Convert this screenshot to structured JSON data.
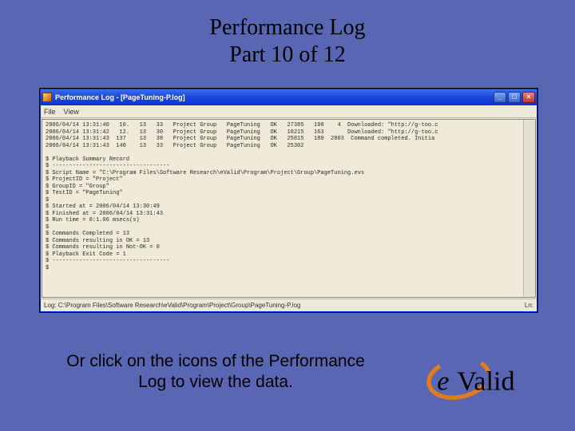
{
  "slide": {
    "title_line1": "Performance Log",
    "title_line2": "Part 10 of 12",
    "caption": "Or click on the icons of the Performance Log to view the data."
  },
  "window": {
    "title": "Performance Log - [PageTuning-P.log]",
    "menu": {
      "file": "File",
      "view": "View"
    },
    "rows": [
      "2006/04/14 13:31:40   10.   13   33   Project Group   PageTuning   OK   27385   190    4  Downloaded: \"http://g-too.c",
      "2006/04/14 13:31:42   12.   13   30   Project Group   PageTuning   OK   10215   163       Downloaded: \"http://g-too.c",
      "2006/04/14 13:31:43  137    13   38   Project Group   PageTuning   OK   25815   180  2803  Command completed. Initia",
      "2006/04/14 13:31:43  140    13   33   Project Group   PageTuning   OK   25302"
    ],
    "summary": {
      "header": "$ Playback Summary Record",
      "sep": "$ -----------------------------------",
      "script_name": "$ Script Name = \"C:\\Program Files\\Software Research\\eValid\\Program\\Project\\Group\\PageTuning.evs",
      "project_id": "$ ProjectID = \"Project\"",
      "group_id": "$ GroupID = \"Group\"",
      "test_id": "$ TestID = \"PageTuning\"",
      "blank1": "$",
      "started": "$ Started at = 2006/04/14 13:30:49",
      "finished": "$ Finished at = 2006/04/14 13:31:43",
      "run_time": "$ Run time = 0:1.06 msecs(s)",
      "blank2": "$",
      "cmds_completed": "$ Commands Completed = 13",
      "cmds_ok": "$ Commands resulting in OK = 13",
      "cmds_notok": "$ Commands resulting in Not-OK = 0",
      "exit_code": "$ Playback Exit Code = 1",
      "sep2": "$ -----------------------------------",
      "last": "$"
    },
    "statusbar": {
      "path": "Log: C:\\Program Files\\Software Research\\eValid\\Program\\Project\\Group\\PageTuning-P.log",
      "right": "Ln:"
    },
    "controls": {
      "min": "_",
      "max": "□",
      "close": "×"
    }
  },
  "logo": {
    "text": "eValid"
  }
}
